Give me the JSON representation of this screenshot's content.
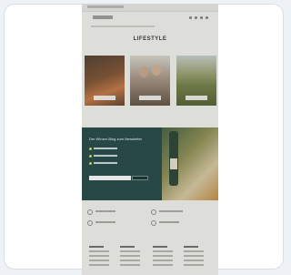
{
  "page": {
    "section_title": "LIFESTYLE"
  },
  "tiles": [
    {
      "name": "food"
    },
    {
      "name": "people"
    },
    {
      "name": "vineyard"
    }
  ],
  "newsletter": {
    "heading": "Der Winzer-Blog zum Newsletter"
  },
  "colors": {
    "newsletter_bg": "#19403f",
    "accent": "#c9d46a"
  }
}
